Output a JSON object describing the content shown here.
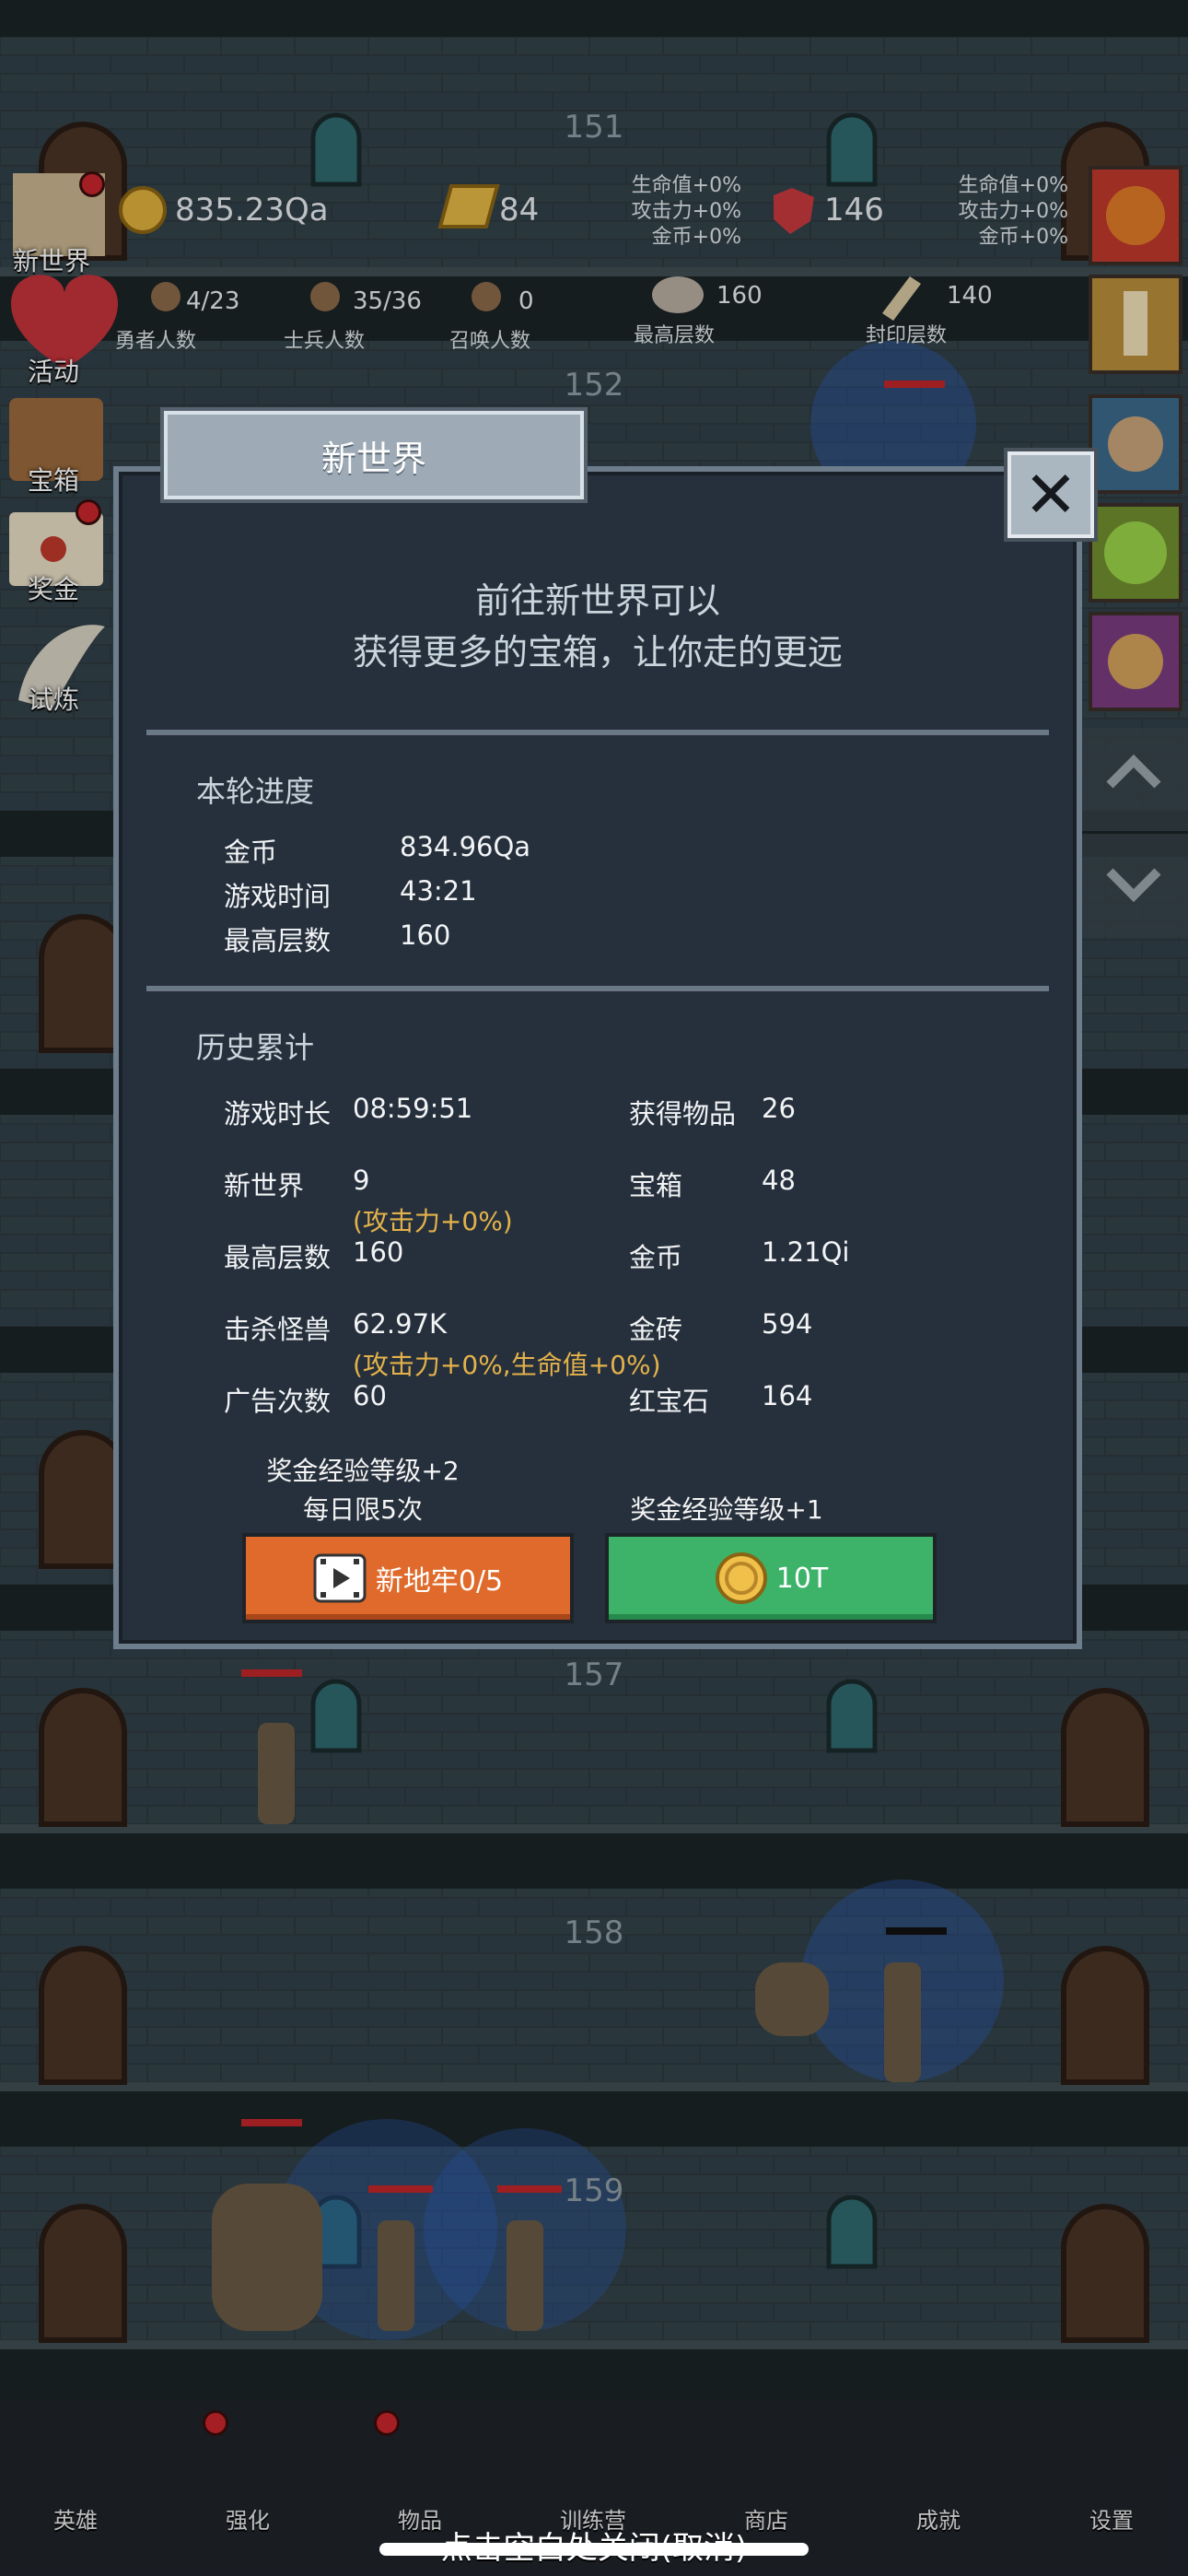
{
  "floors": [
    "151",
    "152",
    "157",
    "158",
    "159"
  ],
  "top_bar": {
    "gold": "835.23Qa",
    "gold_bar": "84",
    "ruby": "146",
    "buff_left": [
      "生命值+0%",
      "攻击力+0%",
      "金币+0%"
    ],
    "buff_right": [
      "生命值+0%",
      "攻击力+0%",
      "金币+0%"
    ]
  },
  "stats": [
    {
      "value": "4/23",
      "label": "勇者人数"
    },
    {
      "value": "35/36",
      "label": "士兵人数"
    },
    {
      "value": "0",
      "label": "召唤人数"
    },
    {
      "value": "160",
      "label": "最高层数"
    },
    {
      "value": "140",
      "label": "封印层数"
    }
  ],
  "left_menu": [
    "新世界",
    "活动",
    "宝箱",
    "奖金",
    "试炼"
  ],
  "modal": {
    "title": "新世界",
    "intro_line1": "前往新世界可以",
    "intro_line2": "获得更多的宝箱，让你走的更远",
    "round_title": "本轮进度",
    "round": [
      {
        "label": "金币",
        "value": "834.96Qa"
      },
      {
        "label": "游戏时间",
        "value": "43:21"
      },
      {
        "label": "最高层数",
        "value": "160"
      }
    ],
    "history_title": "历史累计",
    "history": {
      "play_time_label": "游戏时长",
      "play_time": "08:59:51",
      "items_label": "获得物品",
      "items": "26",
      "new_world_label": "新世界",
      "new_world": "9",
      "new_world_note": "(攻击力+0%)",
      "chest_label": "宝箱",
      "chest": "48",
      "max_floor_label": "最高层数",
      "max_floor": "160",
      "gold_label": "金币",
      "gold": "1.21Qi",
      "kills_label": "击杀怪兽",
      "kills": "62.97K",
      "kills_note": "(攻击力+0%,生命值+0%)",
      "gold_bar_label": "金砖",
      "gold_bar": "594",
      "ads_label": "广告次数",
      "ads": "60",
      "ruby_label": "红宝石",
      "ruby": "164"
    },
    "left_bonus_line1": "奖金经验等级+2",
    "left_bonus_line2": "每日限5次",
    "right_bonus": "奖金经验等级+1",
    "ad_button": "新地牢0/5",
    "gold_button": "10T"
  },
  "bottom_nav": [
    "英雄",
    "强化",
    "物品",
    "训练营",
    "商店",
    "成就",
    "设置"
  ],
  "dismiss_hint": "点击空白处关闭(取消)",
  "colors": {
    "orange": "#e06a2b",
    "green": "#3db36a",
    "panel": "#26303c",
    "note": "#e4b24a"
  }
}
